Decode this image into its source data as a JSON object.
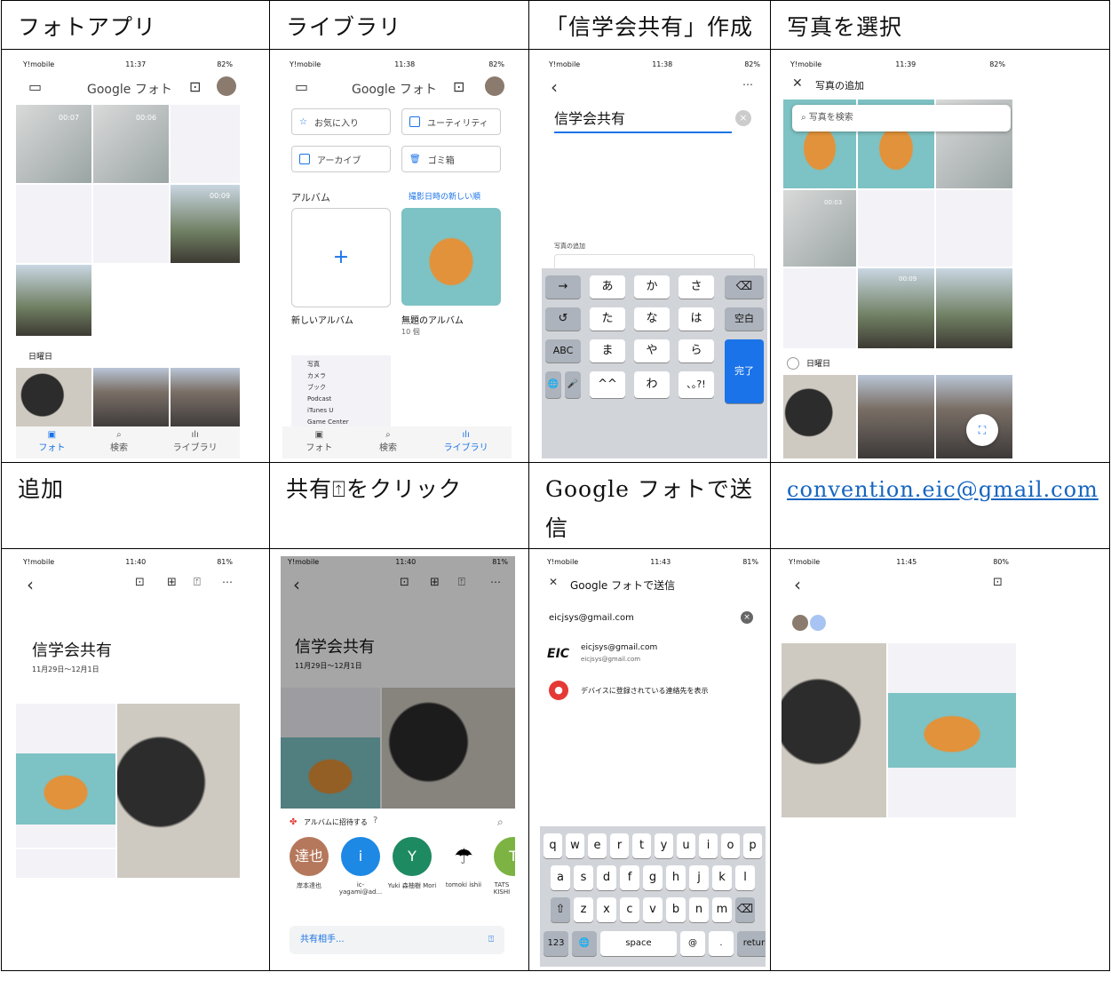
{
  "headers_row1": [
    "フォトアプリ",
    "ライブラリ",
    "「信学会共有」作成",
    "写真を選択"
  ],
  "headers_row2": [
    "追加",
    "共有",
    "をクリック",
    "Google フォトで送信",
    "convention.eic@gmail.com"
  ],
  "status": {
    "carrier": "Y!mobile",
    "times": [
      "11:37",
      "11:38",
      "11:38",
      "11:39",
      "11:40",
      "11:40",
      "11:43",
      "11:45"
    ],
    "battery": [
      "82%",
      "82%",
      "82%",
      "82%",
      "81%",
      "81%",
      "81%",
      "80%"
    ]
  },
  "s1": {
    "logo": "Google フォト",
    "video_times": [
      "00:07",
      "00:06",
      "00:09"
    ],
    "day_label": "日曜日",
    "tabs": [
      "フォト",
      "検索",
      "ライブラリ"
    ]
  },
  "s2": {
    "logo": "Google フォト",
    "chips": [
      "お気に入り",
      "ユーティリティ",
      "アーカイブ",
      "ゴミ箱"
    ],
    "albums_label": "アルバム",
    "sort_label": "撮影日時の新しい順",
    "new_album": "新しいアルバム",
    "untitled_album": "無題のアルバム",
    "untitled_count": "10 個",
    "settings_items": [
      "写真",
      "カメラ",
      "ブック",
      "Podcast",
      "iTunes U",
      "Game Center"
    ],
    "tabs": [
      "フォト",
      "検索",
      "ライブラリ"
    ]
  },
  "s3": {
    "album_title": "信学会共有",
    "add_photos": "写真の追加",
    "kb_rows": [
      [
        "→",
        "あ",
        "か",
        "さ",
        "⌫"
      ],
      [
        "↺",
        "た",
        "な",
        "は",
        "空白"
      ],
      [
        "ABC",
        "ま",
        "や",
        "ら",
        "完了"
      ],
      [
        "🌐",
        "🎤",
        "^^",
        "わ",
        "､｡?!"
      ]
    ]
  },
  "s4": {
    "title": "写真の追加",
    "search_placeholder": "写真を検索",
    "video_times": [
      "00:03",
      "00:09"
    ],
    "day_label": "日曜日"
  },
  "s5": {
    "album_title": "信学会共有",
    "date_range": "11月29日〜12月1日"
  },
  "s6": {
    "album_title": "信学会共有",
    "date_range": "11月29日〜12月1日",
    "invite_label": "アルバムに招待する",
    "contacts": [
      {
        "initial": "達也",
        "name": "岸本達也",
        "color": "#b5785c"
      },
      {
        "initial": "i",
        "name": "ic-yagami@ad...",
        "color": "#1e88e5"
      },
      {
        "initial": "Y",
        "name": "Yuki 森柚樹 Mori",
        "color": "#1e8a62"
      },
      {
        "initial": "",
        "name": "tomoki ishii",
        "color": "#ffffff"
      },
      {
        "initial": "T",
        "name": "TATS KISHI",
        "color": "#7cb342"
      }
    ],
    "share_with": "共有相手..."
  },
  "s7": {
    "title": "Google フォトで送信",
    "input_value": "eicjsys@gmail.com",
    "suggestion_name": "eicjsys@gmail.com",
    "suggestion_sub": "eicjsys@gmail.com",
    "suggestion_logo": "EIC",
    "contacts_label": "デバイスに登録されている連絡先を表示",
    "kb_rows": [
      [
        "q",
        "w",
        "e",
        "r",
        "t",
        "y",
        "u",
        "i",
        "o",
        "p"
      ],
      [
        "a",
        "s",
        "d",
        "f",
        "g",
        "h",
        "j",
        "k",
        "l"
      ],
      [
        "⇧",
        "z",
        "x",
        "c",
        "v",
        "b",
        "n",
        "m",
        "⌫"
      ],
      [
        "123",
        "🌐",
        "space",
        "@",
        ".",
        "return"
      ]
    ]
  },
  "s8": {}
}
